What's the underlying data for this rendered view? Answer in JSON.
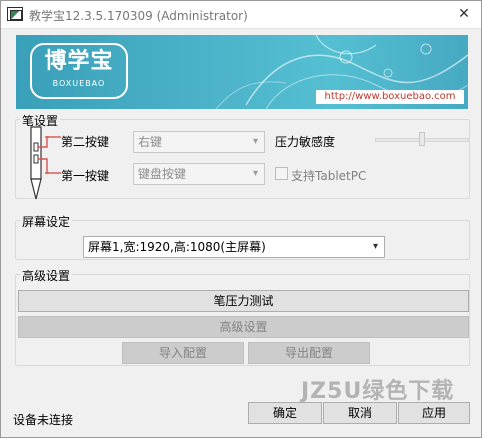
{
  "window": {
    "title": "教学宝12.3.5.170309 (Administrator)",
    "close_glyph": "✕"
  },
  "banner": {
    "logo_text": "博学宝",
    "logo_subtext": "BOXUEBAO",
    "url": "http://www.boxuebao.com"
  },
  "pen_settings": {
    "group_title": "笔设置",
    "second_button_label": "第二按键",
    "second_button_value": "右键",
    "first_button_label": "第一按键",
    "first_button_value": "键盘按键",
    "pressure_label": "压力敏感度",
    "tabletpc_label": "支持TabletPC",
    "tabletpc_checked": false
  },
  "screen_settings": {
    "group_title": "屏幕设定",
    "screen_value": "屏幕1,宽:1920,高:1080(主屏幕)"
  },
  "advanced": {
    "group_title": "高级设置",
    "pressure_test_button": "笔压力测试",
    "advanced_button": "高级设置",
    "import_button": "导入配置",
    "export_button": "导出配置"
  },
  "footer": {
    "status": "设备未连接",
    "ok_button": "确定",
    "cancel_button": "取消",
    "apply_button": "应用"
  },
  "watermark": "JZ5U绿色下载",
  "colors": {
    "banner": "#4bb1c8",
    "url_text": "#c0392b",
    "pen_accent": "#d9534f"
  }
}
